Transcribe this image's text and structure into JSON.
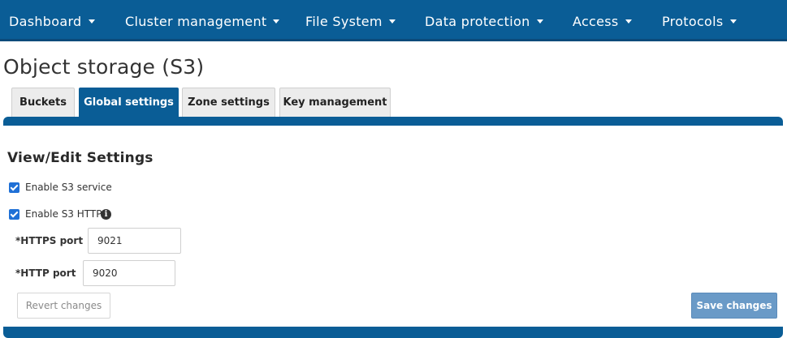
{
  "nav": {
    "items": [
      {
        "label": "Dashboard"
      },
      {
        "label": "Cluster management"
      },
      {
        "label": "File System"
      },
      {
        "label": "Data protection"
      },
      {
        "label": "Access"
      },
      {
        "label": "Protocols"
      }
    ]
  },
  "page": {
    "title": "Object storage (S3)"
  },
  "tabs": [
    {
      "label": "Buckets",
      "active": false
    },
    {
      "label": "Global settings",
      "active": true
    },
    {
      "label": "Zone settings",
      "active": false
    },
    {
      "label": "Key management",
      "active": false
    }
  ],
  "settings": {
    "heading": "View/Edit Settings",
    "enable_s3_service": {
      "label": "Enable S3 service",
      "checked": true
    },
    "enable_s3_http": {
      "label": "Enable S3 HTTP",
      "checked": true,
      "info_icon": "info-icon"
    },
    "https_port": {
      "label": "*HTTPS port",
      "value": "9021"
    },
    "http_port": {
      "label": "*HTTP port",
      "value": "9020"
    }
  },
  "actions": {
    "revert_label": "Revert changes",
    "save_label": "Save changes"
  },
  "colors": {
    "brand": "#0a5d96",
    "checkbox": "#1f70d6",
    "save_button": "#6a9ac7"
  }
}
